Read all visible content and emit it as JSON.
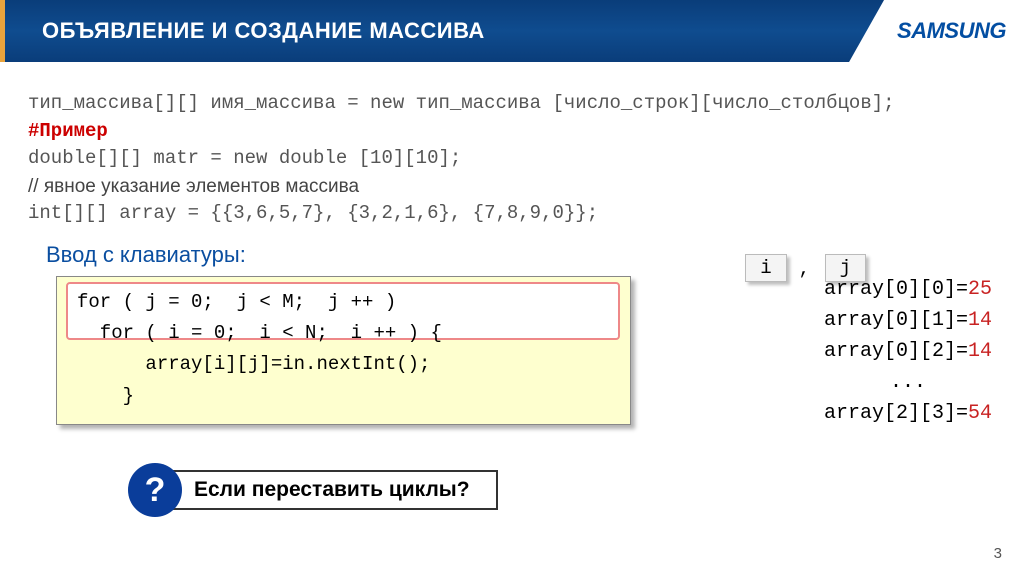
{
  "header": {
    "title": "ОБЪЯВЛЕНИЕ И СОЗДАНИЕ МАССИВА",
    "logo": "SAMSUNG"
  },
  "syntax": {
    "template": "тип_массива[][] имя_массива = new тип_массива [число_строк][число_столбцов];",
    "example_label": "#Пример",
    "example_code": "double[][] matr = new double [10][10];",
    "comment": "// явное указание элементов массива",
    "init_code": "int[][] array = {{3,6,5,7}, {3,2,1,6}, {7,8,9,0}};"
  },
  "input_section": {
    "title": "Ввод с клавиатуры:",
    "line1a": "for ( j = 0;  j < M;  j ++ ) ",
    "line2a": "  for ( i = 0;  i < N;  i ++ ) {",
    "line3": "      array[i][j]=in.nextInt();",
    "line4": "    }"
  },
  "tabs": {
    "i": "i",
    "j": "j",
    "comma": ","
  },
  "output": {
    "r1": {
      "lhs": "array[0][0]=",
      "val": "25"
    },
    "r2": {
      "lhs": "array[0][1]=",
      "val": "14"
    },
    "r3": {
      "lhs": "array[0][2]=",
      "val": "14"
    },
    "dots": "...",
    "r5": {
      "lhs": "array[2][3]=",
      "val": "54"
    }
  },
  "question": {
    "mark": "?",
    "text": "Если переставить циклы?"
  },
  "page_number": "3"
}
